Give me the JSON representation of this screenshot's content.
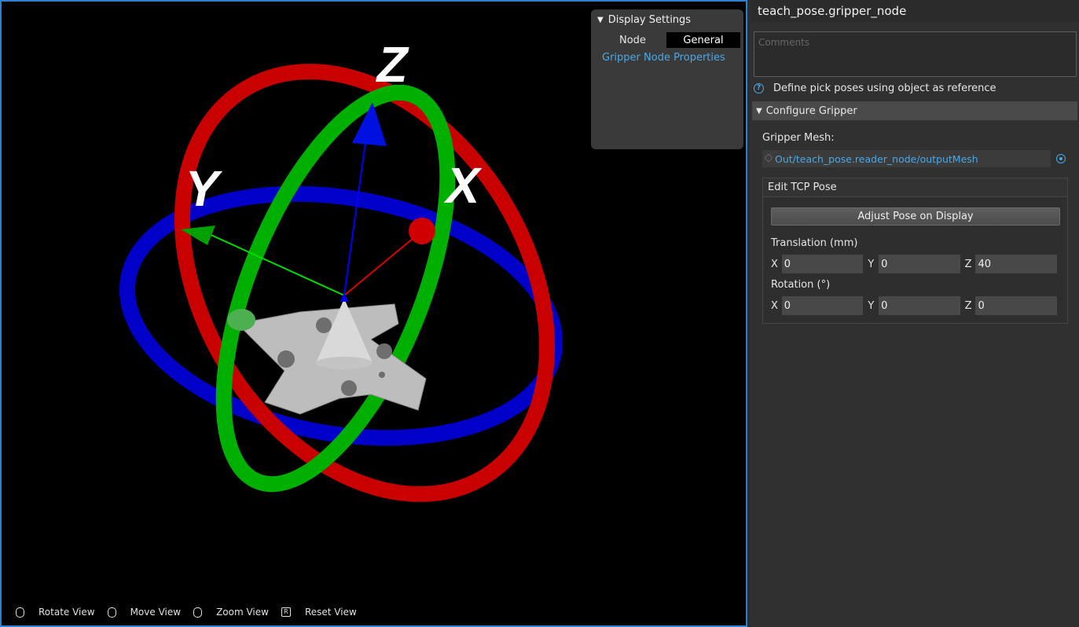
{
  "viewport": {
    "axis_labels": {
      "z": "Z",
      "y": "Y",
      "x": "X"
    },
    "display_settings": {
      "header": "Display Settings",
      "node_label": "Node",
      "node_value": "General",
      "link": "Gripper Node Properties"
    },
    "hints": [
      {
        "icon": "mouse-left-icon",
        "label": "Rotate View"
      },
      {
        "icon": "mouse-right-icon",
        "label": "Move View"
      },
      {
        "icon": "mouse-wheel-icon",
        "label": "Zoom View"
      },
      {
        "icon": "r-key-icon",
        "key": "R",
        "label": "Reset View"
      }
    ]
  },
  "panel": {
    "title": "teach_pose.gripper_node",
    "comments_placeholder": "Comments",
    "help_text": "Define pick poses using object as reference",
    "configure_section": "Configure Gripper",
    "gripper_mesh_label": "Gripper Mesh:",
    "gripper_mesh_value": "Out/teach_pose.reader_node/outputMesh",
    "tcp_title": "Edit TCP Pose",
    "adjust_button": "Adjust Pose on Display",
    "translation_label": "Translation (mm)",
    "translation": {
      "x": "0",
      "y": "0",
      "z": "40"
    },
    "rotation_label": "Rotation (°)",
    "rotation": {
      "x": "0",
      "y": "0",
      "z": "0"
    },
    "axis_x": "X",
    "axis_y": "Y",
    "axis_z": "Z"
  },
  "colors": {
    "accent": "#2e7fd1",
    "link": "#4aa8e8",
    "x_axis": "#cc0000",
    "y_axis": "#00aa00",
    "z_axis": "#0000cc"
  }
}
